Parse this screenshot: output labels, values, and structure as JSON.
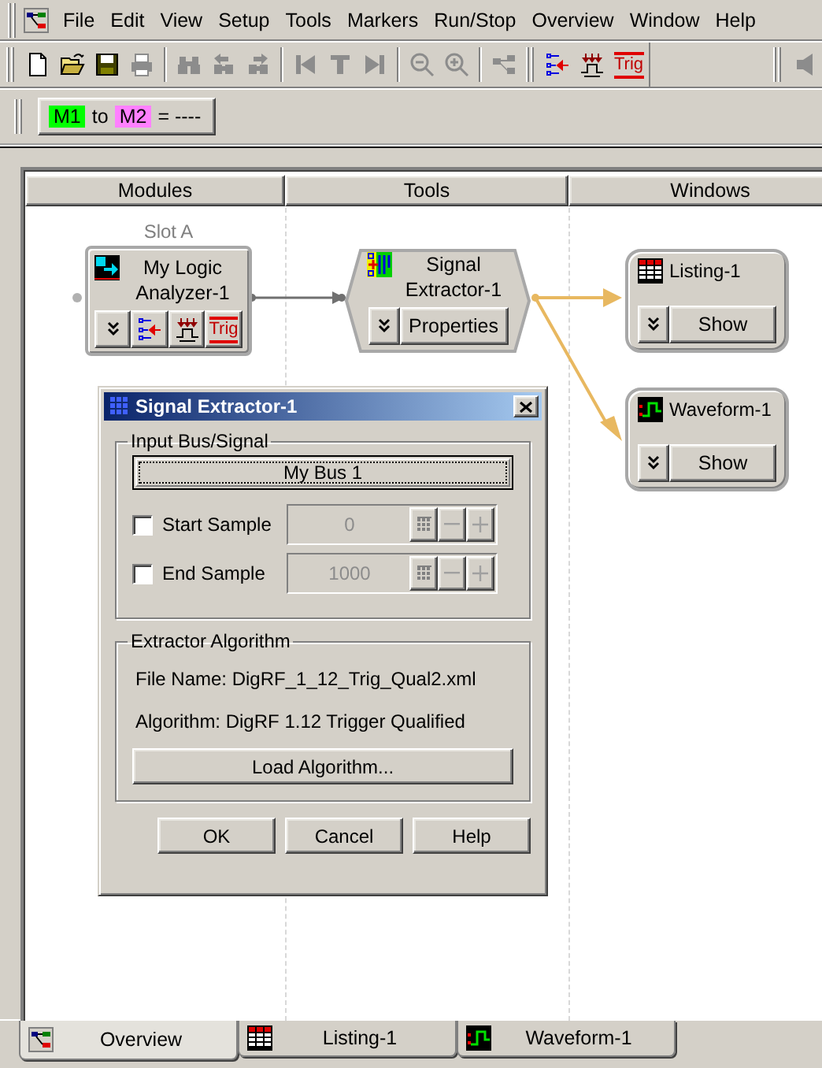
{
  "menu": [
    "File",
    "Edit",
    "View",
    "Setup",
    "Tools",
    "Markers",
    "Run/Stop",
    "Overview",
    "Window",
    "Help"
  ],
  "toolbar": [
    {
      "kind": "new",
      "disabled": false
    },
    {
      "kind": "open",
      "disabled": false
    },
    {
      "kind": "save",
      "disabled": false
    },
    {
      "kind": "print",
      "disabled": true
    },
    {
      "kind": "separator"
    },
    {
      "kind": "find",
      "disabled": true
    },
    {
      "kind": "find_prev",
      "disabled": true
    },
    {
      "kind": "find_next",
      "disabled": true
    },
    {
      "kind": "separator"
    },
    {
      "kind": "go_start",
      "disabled": true
    },
    {
      "kind": "go_trigger",
      "disabled": true
    },
    {
      "kind": "go_end",
      "disabled": true
    },
    {
      "kind": "separator"
    },
    {
      "kind": "zoom_out",
      "disabled": true
    },
    {
      "kind": "zoom_in",
      "disabled": true
    },
    {
      "kind": "separator"
    },
    {
      "kind": "overview",
      "disabled": true
    },
    {
      "kind": "grip"
    },
    {
      "kind": "bus_signal",
      "disabled": false
    },
    {
      "kind": "sampling",
      "disabled": false
    },
    {
      "kind": "trigger",
      "label": "Trig",
      "disabled": false
    },
    {
      "kind": "spacer"
    },
    {
      "kind": "grip"
    },
    {
      "kind": "speaker",
      "disabled": true
    }
  ],
  "marker_bar": {
    "markers": [
      {
        "label": "M1",
        "color": "#00ff00"
      },
      {
        "label": "M2",
        "color": "#ff80ff"
      }
    ],
    "connector": "to",
    "result": "= ----"
  },
  "canvas": {
    "columns": [
      "Modules",
      "Tools",
      "Windows"
    ],
    "slot_label": "Slot A",
    "module": {
      "title": "My Logic Analyzer-1",
      "trig_label": "Trig"
    },
    "tool": {
      "title": "Signal Extractor-1",
      "button": "Properties"
    },
    "windows": [
      {
        "kind": "listing",
        "title": "Listing-1",
        "button": "Show"
      },
      {
        "kind": "waveform",
        "title": "Waveform-1",
        "button": "Show"
      }
    ]
  },
  "dialog": {
    "title": "Signal Extractor-1",
    "input_group": {
      "title": "Input Bus/Signal",
      "bus_button": "My Bus 1",
      "rows": [
        {
          "label": "Start Sample",
          "checked": false,
          "value": "0",
          "disabled": true
        },
        {
          "label": "End Sample",
          "checked": false,
          "value": "1000",
          "disabled": true
        }
      ]
    },
    "algorithm_group": {
      "title": "Extractor Algorithm",
      "file_name": "File Name: DigRF_1_12_Trig_Qual2.xml",
      "algorithm": "Algorithm: DigRF 1.12 Trigger Qualified",
      "load_button": "Load Algorithm..."
    },
    "buttons": [
      "OK",
      "Cancel",
      "Help"
    ]
  },
  "tabs": [
    {
      "kind": "overview",
      "label": "Overview",
      "selected": true
    },
    {
      "kind": "listing",
      "label": "Listing-1",
      "selected": false
    },
    {
      "kind": "waveform",
      "label": "Waveform-1",
      "selected": false
    }
  ]
}
